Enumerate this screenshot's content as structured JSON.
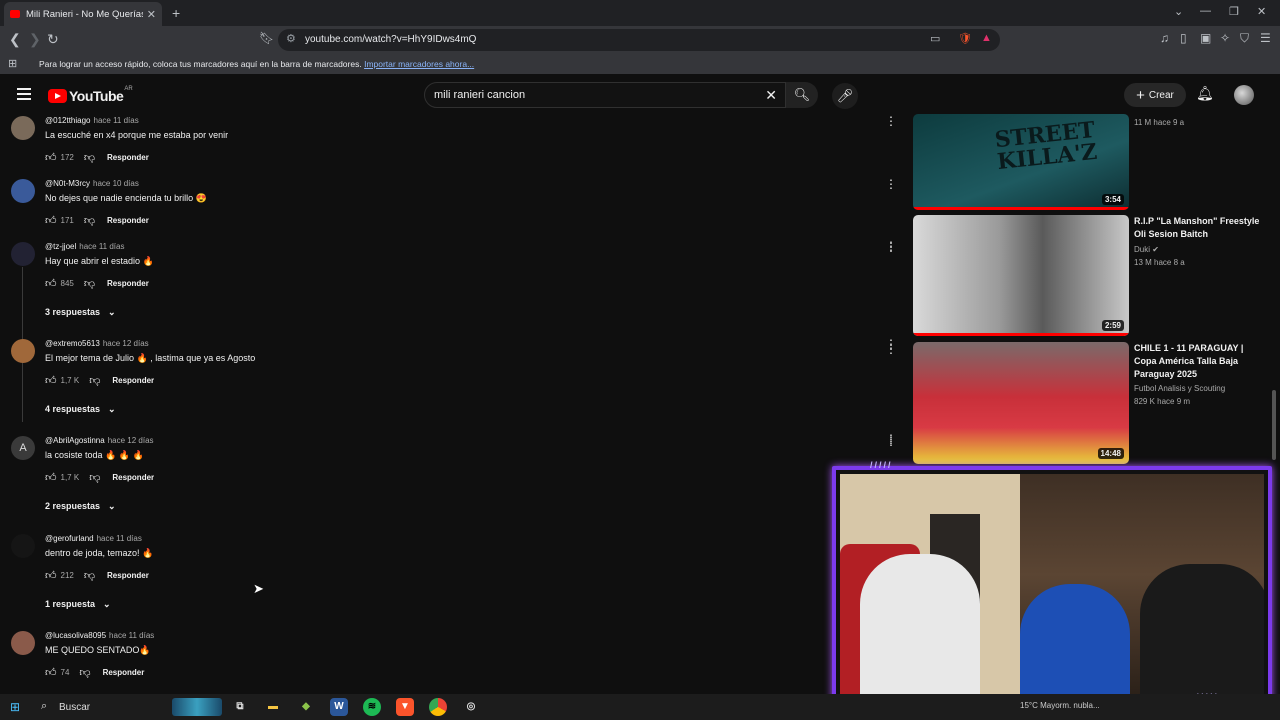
{
  "browser": {
    "tab_title": "Mili Ranieri - No Me Querías A M",
    "url": "youtube.com/watch?v=HhY9IDws4mQ",
    "bookmarks_message": "Para lograr un acceso rápido, coloca tus marcadores aquí en la barra de marcadores.",
    "bookmarks_link": "Importar marcadores ahora..."
  },
  "youtube": {
    "logo_text": "YouTube",
    "region": "AR",
    "search_value": "mili ranieri cancion",
    "create_label": "Crear"
  },
  "comments": [
    {
      "handle": "@012tthiago",
      "time": "hace 11 días",
      "text": "La escuché en x4 porque me estaba por venir",
      "likes": "172",
      "reply": "Responder",
      "avatar_color": "#7a6a5a"
    },
    {
      "handle": "@N0t-M3rcy",
      "time": "hace 10 días",
      "text": "No dejes que nadie encienda tu brillo 😍",
      "likes": "171",
      "reply": "Responder",
      "avatar_color": "#3a5a9a"
    },
    {
      "handle": "@tz-jjoel",
      "time": "hace 11 días",
      "text": "Hay que abrir el estadio 🔥",
      "likes": "845",
      "reply": "Responder",
      "avatar_color": "#222233",
      "replies": "3 respuestas"
    },
    {
      "handle": "@extremo5613",
      "time": "hace 12 días",
      "text": "El mejor tema de Julio 🔥 , lastima que ya es Agosto",
      "likes": "1,7 K",
      "reply": "Responder",
      "avatar_color": "#a0683a",
      "replies": "4 respuestas"
    },
    {
      "handle": "@AbrilAgostinna",
      "time": "hace 12 días",
      "text": "la cosiste toda 🔥 🔥 🔥",
      "likes": "1,7 K",
      "reply": "Responder",
      "avatar_color": "#3a3a3a",
      "avatar_letter": "A",
      "replies": "2 respuestas"
    },
    {
      "handle": "@gerofurland",
      "time": "hace 11 días",
      "text": "dentro de joda, temazo! 🔥",
      "likes": "212",
      "reply": "Responder",
      "avatar_color": "#151515",
      "replies": "1 respuesta"
    },
    {
      "handle": "@lucasoliva8095",
      "time": "hace 11 días",
      "text": "ME QUEDO SENTADO🔥",
      "likes": "74",
      "reply": "Responder",
      "avatar_color": "#8a5a4a"
    }
  ],
  "videos": [
    {
      "title": "",
      "channel": "",
      "meta": "11 M  hace 9 a",
      "duration": "3:54",
      "thumb_text": "STREET KILLA'Z"
    },
    {
      "title": "R.I.P \"La Manshon\" Freestyle Oli Sesion Baitch",
      "channel": "Duki",
      "meta": "13 M  hace 8 a",
      "duration": "2:59"
    },
    {
      "title": "CHILE 1 - 11 PARAGUAY | Copa América Talla Baja Paraguay 2025",
      "channel": "Futbol Analisis y Scouting",
      "meta": "829 K  hace 9 m",
      "duration": "14:48"
    }
  ],
  "taskbar": {
    "search_label": "Buscar",
    "weather": "15°C  Mayorm. nubla..."
  }
}
